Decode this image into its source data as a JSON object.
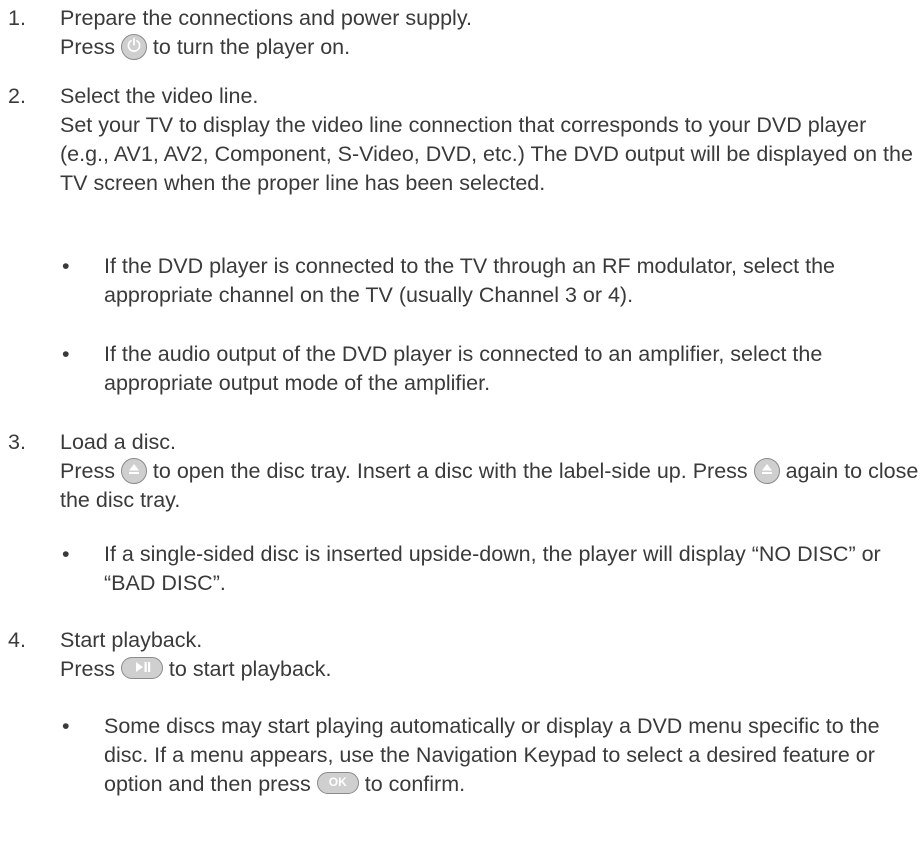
{
  "steps": [
    {
      "number": "1.",
      "title": "Prepare the connections and power supply.",
      "body_before_icon": "Press ",
      "icon": "power-icon",
      "body_after_icon": " to turn the player on."
    },
    {
      "number": "2.",
      "title": "Select the video line.",
      "body": "Set your TV to display the video line connection that corresponds to your DVD player (e.g., AV1, AV2, Component, S-Video, DVD, etc.) The DVD output will be displayed on the TV screen when the proper line has been selected.",
      "bullets": [
        "If the DVD player is connected to the TV through an RF modulator, select the appropriate channel on the TV (usually Channel 3 or 4).",
        "If the audio output of the DVD player is connected to an amplifier, select the appropriate output mode of the amplifier."
      ]
    },
    {
      "number": "3.",
      "title": "Load a disc.",
      "body_part1": "Press ",
      "icon": "eject-icon",
      "body_part2": " to open the disc tray. Insert a disc with the label-side up. Press ",
      "body_part3": " again to close the disc tray.",
      "bullets": [
        "If a single-sided disc is inserted upside-down, the player will display “NO DISC” or “BAD DISC”."
      ]
    },
    {
      "number": "4.",
      "title": "Start playback.",
      "body_before_icon": "Press ",
      "icon": "play-pause-icon",
      "body_after_icon": " to start playback.",
      "bullet_before_icon": "Some discs may start playing automatically or display a DVD menu specific to the disc. If a menu appears, use the Navigation Keypad to select a desired feature or option and then press ",
      "ok_label": "OK",
      "bullet_after_icon": " to confirm."
    }
  ],
  "bullet_symbol": "•"
}
